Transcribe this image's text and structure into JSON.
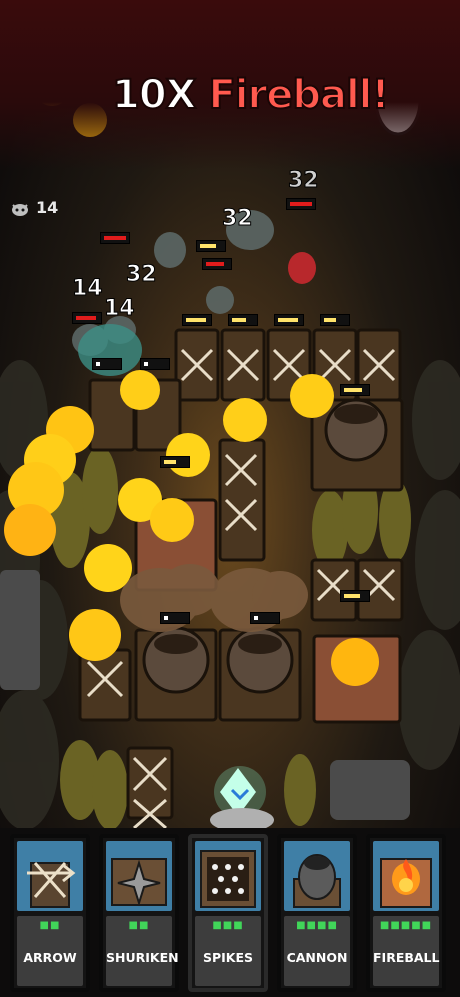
{
  "banner": {
    "multiplier": "10X",
    "spell": "Fireball!"
  },
  "hud": {
    "enemy_count": "14"
  },
  "damage_numbers": [
    "32",
    "32",
    "32",
    "14",
    "14"
  ],
  "cards": [
    {
      "label": "ARROW",
      "pips": "■■"
    },
    {
      "label": "SHURIKEN",
      "pips": "■■"
    },
    {
      "label": "SPIKES",
      "pips": "■■■"
    },
    {
      "label": "CANNON",
      "pips": "■■■■"
    },
    {
      "label": "FIREBALL",
      "pips": "■■■■■"
    }
  ]
}
